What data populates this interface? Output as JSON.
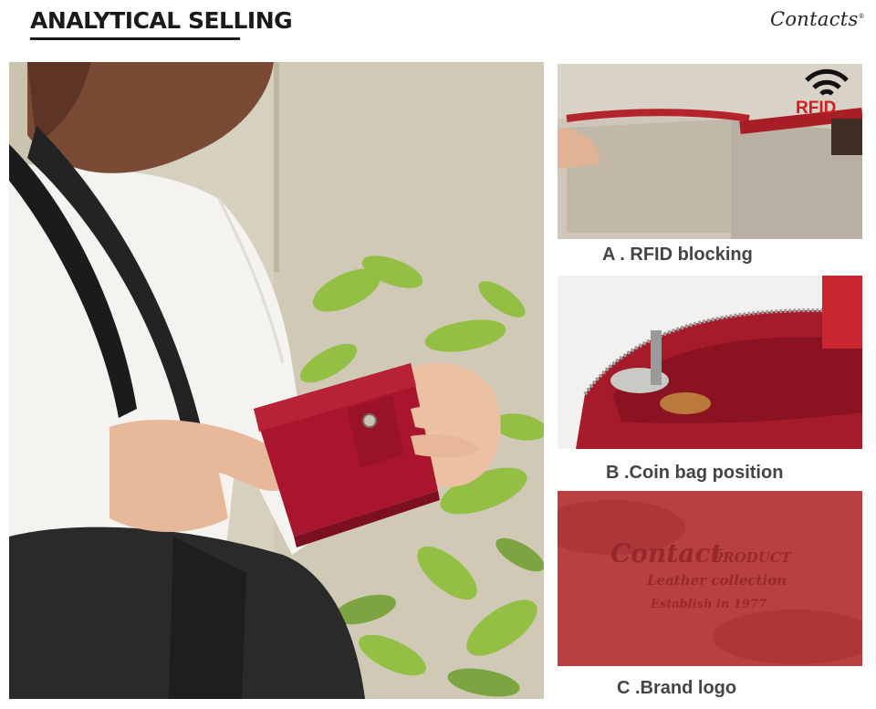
{
  "header": {
    "title": "ANALYTICAL SELLING",
    "brand": "Contacts"
  },
  "panels": {
    "a": {
      "caption": "A . RFID  blocking",
      "badge_text": "RFID"
    },
    "b": {
      "caption": "B .Coin bag position"
    },
    "c": {
      "caption": "C .Brand logo"
    }
  },
  "colors": {
    "wallet_red": "#a8152d",
    "leaf_green": "#8fbf3e",
    "rfid_red": "#d21e22"
  }
}
